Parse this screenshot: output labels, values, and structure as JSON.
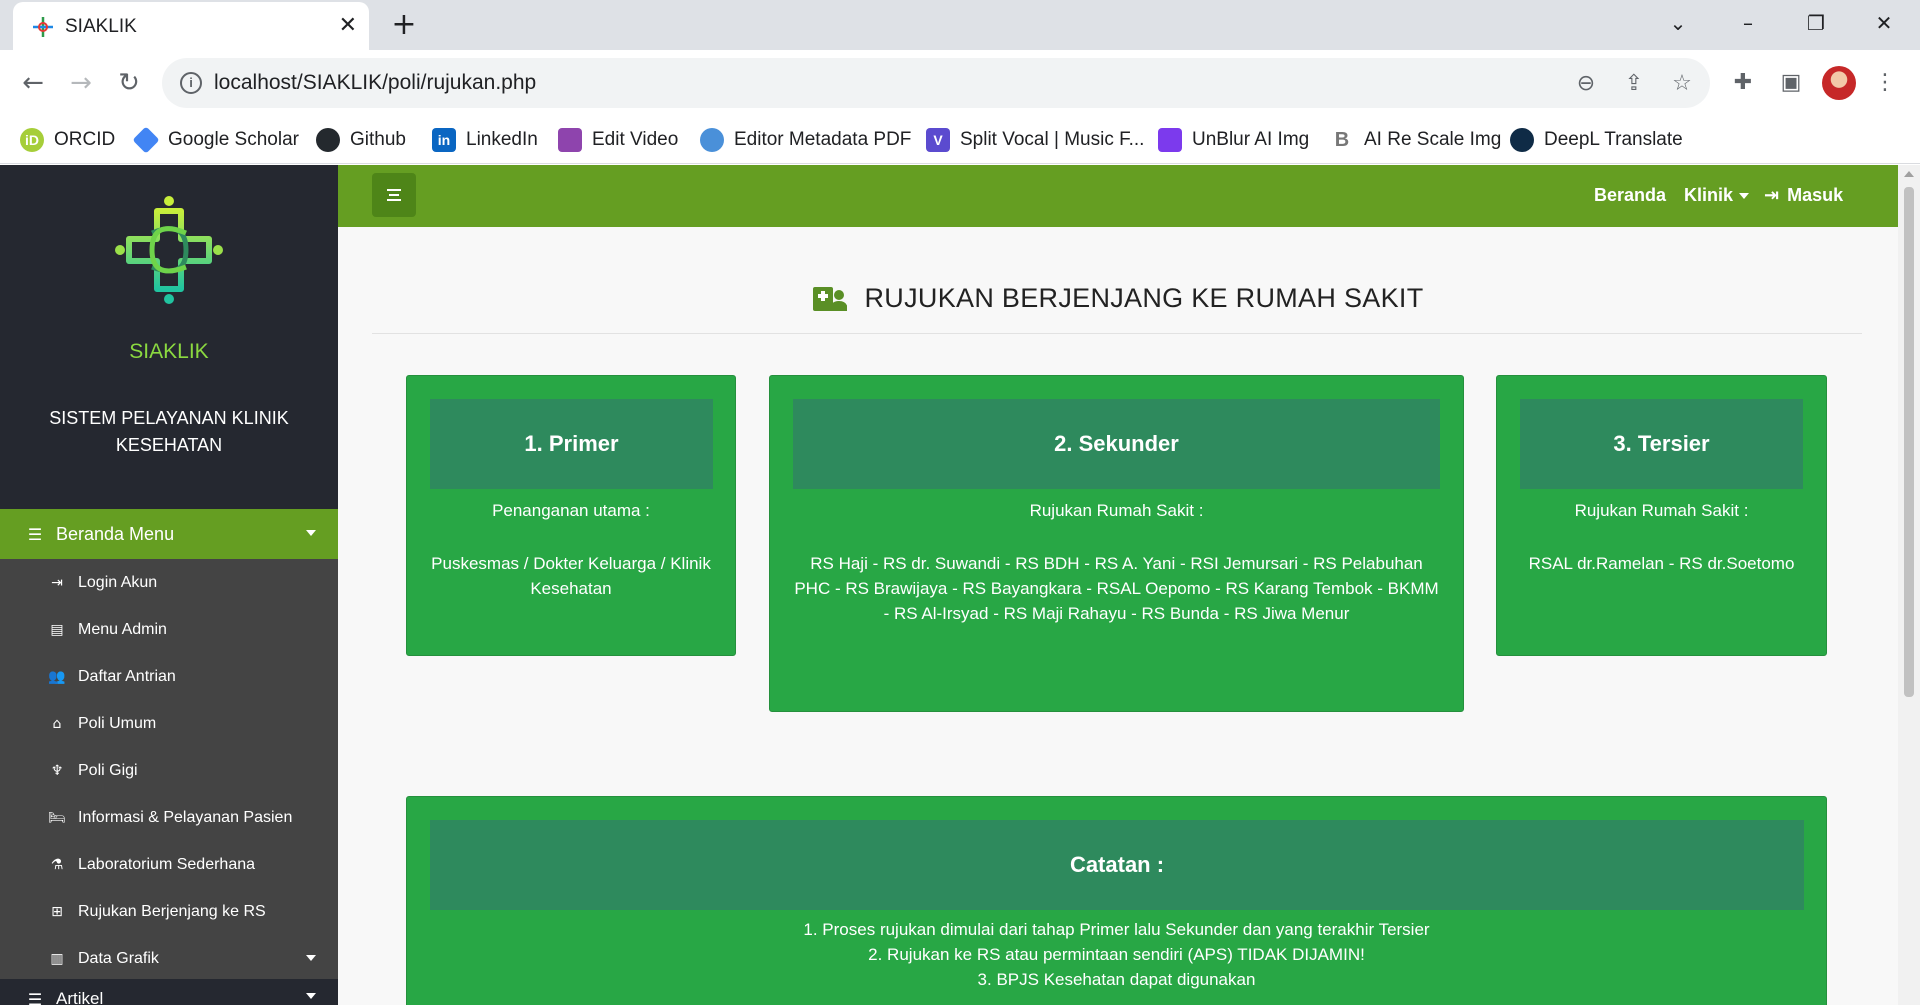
{
  "browser": {
    "tab_title": "SIAKLIK",
    "url": "localhost/SIAKLIK/poli/rujukan.php",
    "bookmarks": [
      {
        "label": "ORCID",
        "icon": "orcid-icon",
        "color": "#a6ce39",
        "glyph": "iD"
      },
      {
        "label": "Google Scholar",
        "icon": "google-scholar-icon",
        "color": "#4285f4",
        "glyph": ""
      },
      {
        "label": "Github",
        "icon": "github-icon",
        "color": "#24292e",
        "glyph": ""
      },
      {
        "label": "LinkedIn",
        "icon": "linkedin-icon",
        "color": "#0a66c2",
        "glyph": "in"
      },
      {
        "label": "Edit Video",
        "icon": "edit-video-icon",
        "color": "#8e44ad",
        "glyph": ""
      },
      {
        "label": "Editor Metadata PDF",
        "icon": "metadata-pdf-icon",
        "color": "#4a90d9",
        "glyph": ""
      },
      {
        "label": "Split Vocal | Music F...",
        "icon": "split-vocal-icon",
        "color": "#5b4bcf",
        "glyph": "V"
      },
      {
        "label": "UnBlur AI Img",
        "icon": "unblur-icon",
        "color": "#7c3aed",
        "glyph": ""
      },
      {
        "label": "AI Re Scale Img",
        "icon": "rescale-icon",
        "color": "#9e9e9e",
        "glyph": "B"
      },
      {
        "label": "DeepL Translate",
        "icon": "deepl-icon",
        "color": "#0f2b46",
        "glyph": ""
      }
    ]
  },
  "sidebar": {
    "brand_name": "SIAKLIK",
    "brand_subtitle": "SISTEM PELAYANAN KLINIK KESEHATAN",
    "menu_head": "Beranda Menu",
    "items": [
      {
        "label": "Login Akun",
        "icon": "login-icon"
      },
      {
        "label": "Menu Admin",
        "icon": "book-icon"
      },
      {
        "label": "Daftar Antrian",
        "icon": "users-icon"
      },
      {
        "label": "Poli Umum",
        "icon": "home-icon"
      },
      {
        "label": "Poli Gigi",
        "icon": "tooth-icon"
      },
      {
        "label": "Informasi & Pelayanan Pasien",
        "icon": "bed-icon"
      },
      {
        "label": "Laboratorium Sederhana",
        "icon": "flask-icon"
      },
      {
        "label": "Rujukan Berjenjang ke RS",
        "icon": "hospital-user-icon"
      },
      {
        "label": "Data Grafik",
        "icon": "chart-icon"
      }
    ],
    "bottom_item": "Artikel"
  },
  "topnav": {
    "links": [
      "Beranda",
      "Klinik",
      "Masuk"
    ]
  },
  "content": {
    "heading": "RUJUKAN BERJENJANG KE RUMAH SAKIT",
    "cards": [
      {
        "title": "1. Primer",
        "subtitle": "Penanganan utama :",
        "body": "Puskesmas / Dokter Keluarga / Klinik Kesehatan"
      },
      {
        "title": "2. Sekunder",
        "subtitle": "Rujukan Rumah Sakit :",
        "body": "RS Haji - RS dr. Suwandi - RS BDH - RS A. Yani - RSI Jemursari - RS Pelabuhan PHC - RS Brawijaya - RS Bayangkara - RSAL Oepomo - RS Karang Tembok - BKMM - RS Al-Irsyad - RS Maji Rahayu - RS Bunda - RS Jiwa Menur"
      },
      {
        "title": "3. Tersier",
        "subtitle": "Rujukan Rumah Sakit :",
        "body": "RSAL dr.Ramelan - RS dr.Soetomo"
      }
    ],
    "note": {
      "title": "Catatan :",
      "items": [
        "1.  Proses rujukan dimulai dari tahap Primer lalu Sekunder dan yang terakhir Tersier",
        "2.  Rujukan ke RS atau permintaan sendiri (APS) TIDAK DIJAMIN!",
        "3.  BPJS Kesehatan dapat digunakan"
      ]
    }
  },
  "colors": {
    "primary_green": "#659e22",
    "card_green": "#28a745",
    "card_header": "#2e8a5d",
    "sidebar_dark": "#252830",
    "sidebar_gray": "#444444",
    "brand_green": "#8bd940"
  }
}
